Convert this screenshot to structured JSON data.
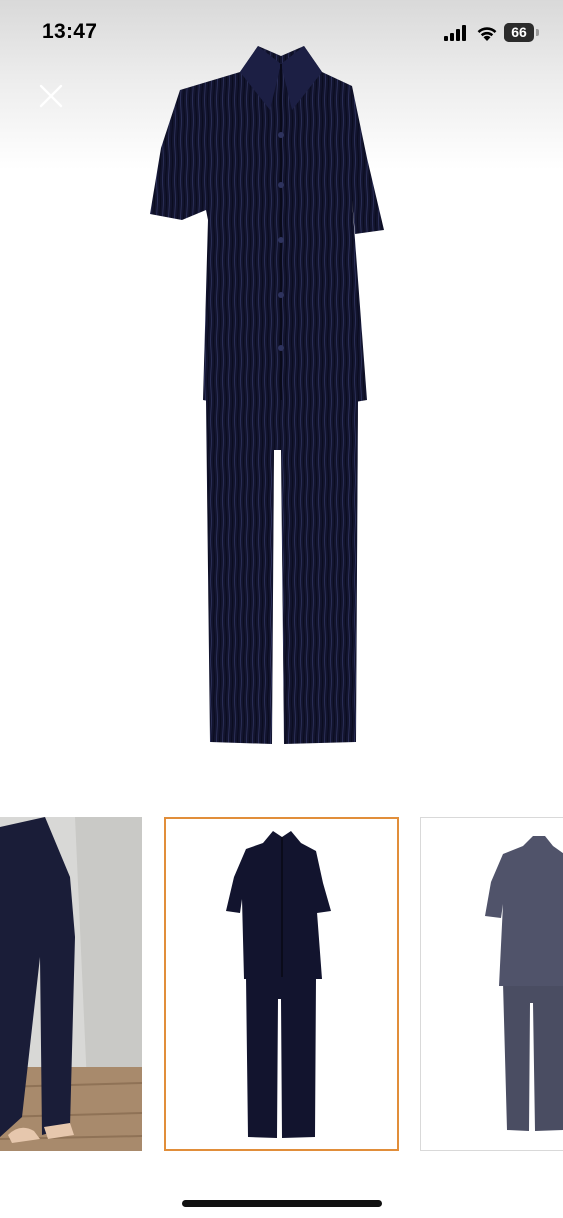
{
  "status_bar": {
    "time": "13:47",
    "battery_level": "66",
    "icons": [
      "cellular-signal-icon",
      "wifi-icon",
      "battery-icon"
    ]
  },
  "viewer": {
    "close_icon": "close-icon",
    "main_image_alt": "product-image-navy-pleated-shirt-and-trousers-set",
    "selected_thumbnail": 2,
    "thumbnails": [
      {
        "name": "thumbnail-model-wearing-trousers"
      },
      {
        "name": "thumbnail-front-flat-lay"
      },
      {
        "name": "thumbnail-back-view"
      }
    ]
  },
  "colors": {
    "garment": "#12142e",
    "selected_border": "#e18e3a",
    "status_text": "#000000"
  }
}
